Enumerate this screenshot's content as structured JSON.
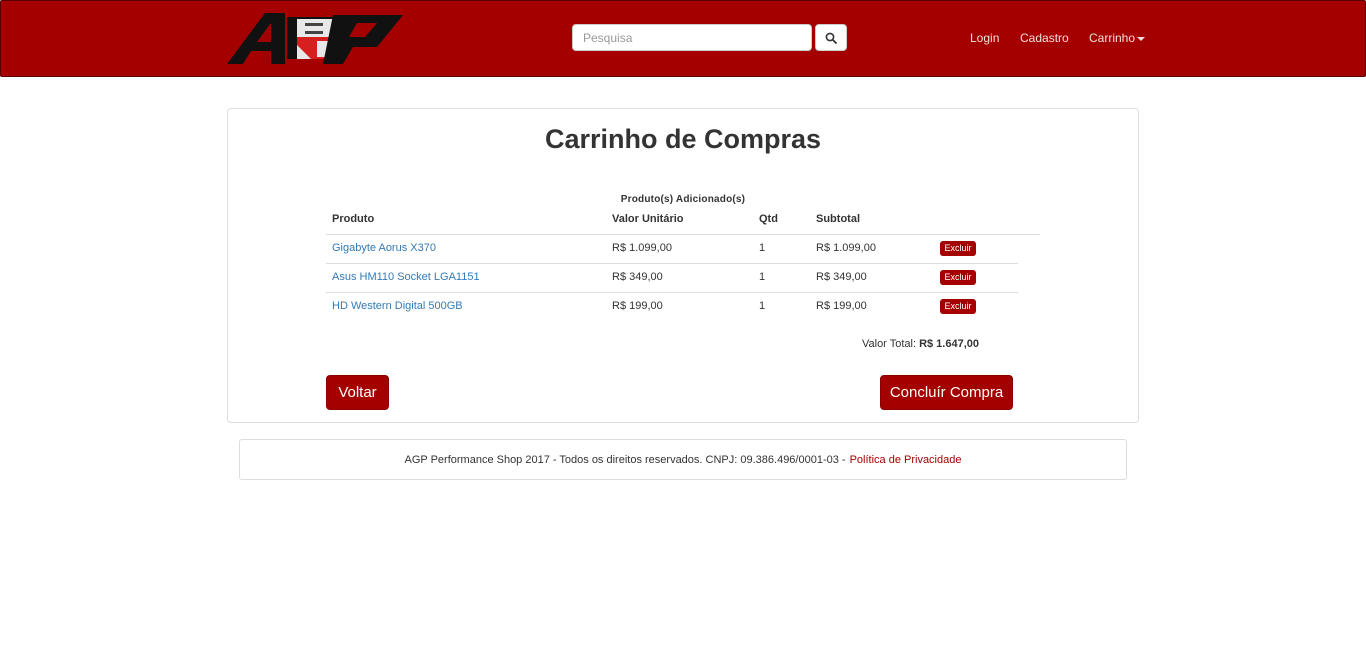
{
  "header": {
    "search_placeholder": "Pesquisa",
    "nav": {
      "login": "Login",
      "cadastro": "Cadastro",
      "carrinho": "Carrinho"
    }
  },
  "cart": {
    "title": "Carrinho de Compras",
    "caption": "Produto(s) Adicionado(s)",
    "columns": {
      "produto": "Produto",
      "valor_unitario": "Valor Unitário",
      "qtd": "Qtd",
      "subtotal": "Subtotal"
    },
    "items": [
      {
        "produto": "Gigabyte Aorus X370",
        "valor": "R$ 1.099,00",
        "qtd": "1",
        "subtotal": "R$ 1.099,00",
        "action": "Excluir"
      },
      {
        "produto": "Asus HM110 Socket LGA1151",
        "valor": "R$ 349,00",
        "qtd": "1",
        "subtotal": "R$ 349,00",
        "action": "Excluir"
      },
      {
        "produto": "HD Western Digital 500GB",
        "valor": "R$ 199,00",
        "qtd": "1",
        "subtotal": "R$ 199,00",
        "action": "Excluir"
      }
    ],
    "total_label": "Valor Total:",
    "total_value": "R$ 1.647,00",
    "back_label": "Voltar",
    "finish_label": "Concluír Compra"
  },
  "footer": {
    "text": "AGP Performance Shop 2017 - Todos os direitos reservados. CNPJ: 09.386.496/0001-03 -",
    "link": "Política de Privacidade"
  },
  "colors": {
    "brand_red": "#a50000",
    "link_blue": "#337ab7"
  }
}
